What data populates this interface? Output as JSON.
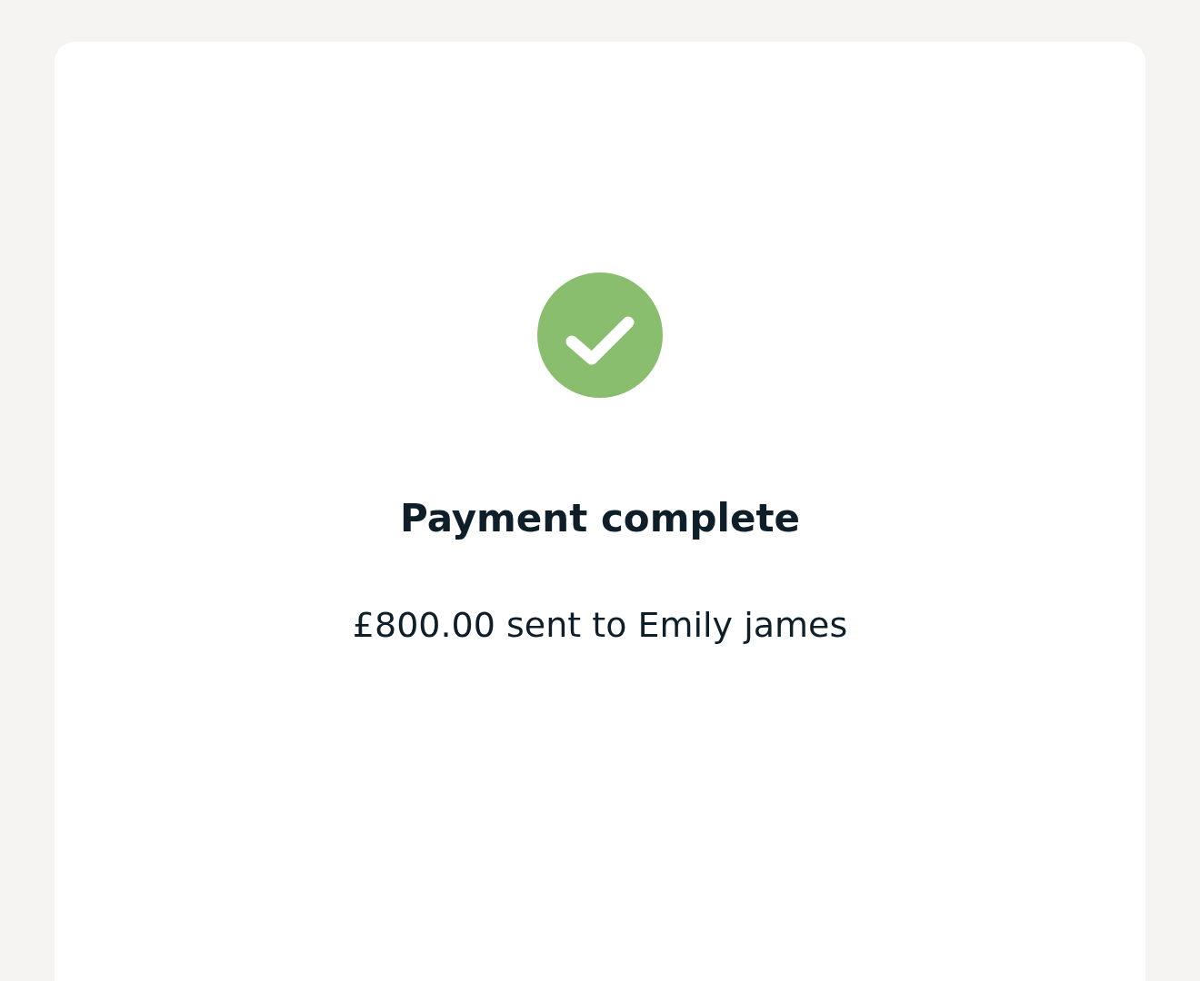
{
  "status": {
    "kind": "success"
  },
  "title": "Payment complete",
  "message": "£800.00 sent to Emily james"
}
